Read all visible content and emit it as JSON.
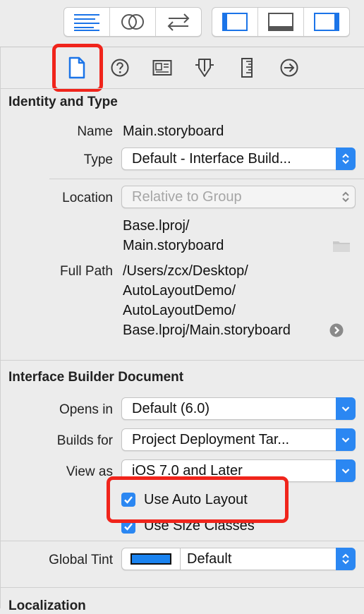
{
  "toolbar": {
    "left_group": [
      "standard-editor-icon",
      "assistant-editor-icon",
      "version-editor-icon"
    ],
    "right_group": [
      "navigator-toggle-icon",
      "debug-area-toggle-icon",
      "utilities-toggle-icon"
    ]
  },
  "inspector_tabs": [
    "file-inspector-icon",
    "quick-help-icon",
    "identity-inspector-icon",
    "attributes-inspector-icon",
    "size-inspector-icon",
    "connections-inspector-icon"
  ],
  "identity": {
    "title": "Identity and Type",
    "name_label": "Name",
    "name_value": "Main.storyboard",
    "type_label": "Type",
    "type_value": "Default - Interface Build...",
    "location_label": "Location",
    "location_value": "Relative to Group",
    "relative_path_line1": "Base.lproj/",
    "relative_path_line2": "Main.storyboard",
    "full_path_label": "Full Path",
    "full_path_line1": "/Users/zcx/Desktop/",
    "full_path_line2": "AutoLayoutDemo/",
    "full_path_line3": "AutoLayoutDemo/",
    "full_path_line4": "Base.lproj/Main.storyboard"
  },
  "ib_document": {
    "title": "Interface Builder Document",
    "opens_in_label": "Opens in",
    "opens_in_value": "Default (6.0)",
    "builds_for_label": "Builds for",
    "builds_for_value": "Project Deployment Tar...",
    "view_as_label": "View as",
    "view_as_value": "iOS 7.0 and Later",
    "auto_layout_label": "Use Auto Layout",
    "auto_layout_checked": true,
    "size_classes_label": "Use Size Classes",
    "size_classes_checked": true,
    "global_tint_label": "Global Tint",
    "global_tint_value": "Default",
    "global_tint_color": "#1a83f0"
  },
  "localization": {
    "title": "Localization"
  },
  "colors": {
    "accent": "#2b87f2",
    "highlight": "#f0241b",
    "toolbar_icon": "#1b74e8"
  }
}
